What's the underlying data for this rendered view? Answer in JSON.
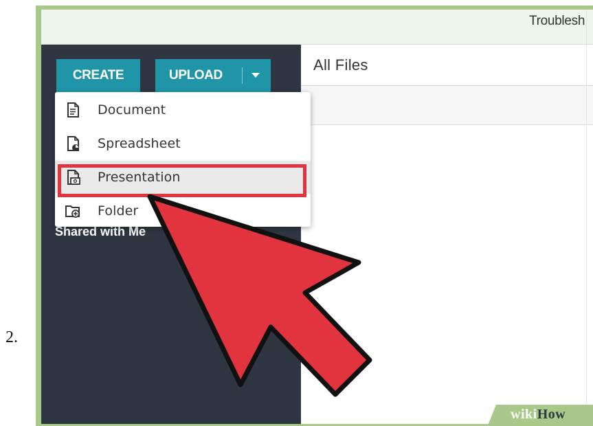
{
  "step": {
    "number": "2."
  },
  "topbar": {
    "link": "Troublesh"
  },
  "sidebar": {
    "create_label": "CREATE",
    "upload_label": "UPLOAD",
    "shared_label": "Shared with Me"
  },
  "main": {
    "title": "All Files"
  },
  "dropdown": {
    "items": [
      {
        "label": "Document",
        "icon": "document-icon"
      },
      {
        "label": "Spreadsheet",
        "icon": "spreadsheet-icon"
      },
      {
        "label": "Presentation",
        "icon": "presentation-icon",
        "highlighted": true
      },
      {
        "label": "Folder",
        "icon": "folder-icon"
      }
    ]
  },
  "watermark": {
    "wiki": "wiki",
    "how": "How"
  },
  "colors": {
    "frame": "#a8c98a",
    "sidebar": "#2e3641",
    "button": "#1f95a7",
    "arrow": "#e2343f"
  }
}
